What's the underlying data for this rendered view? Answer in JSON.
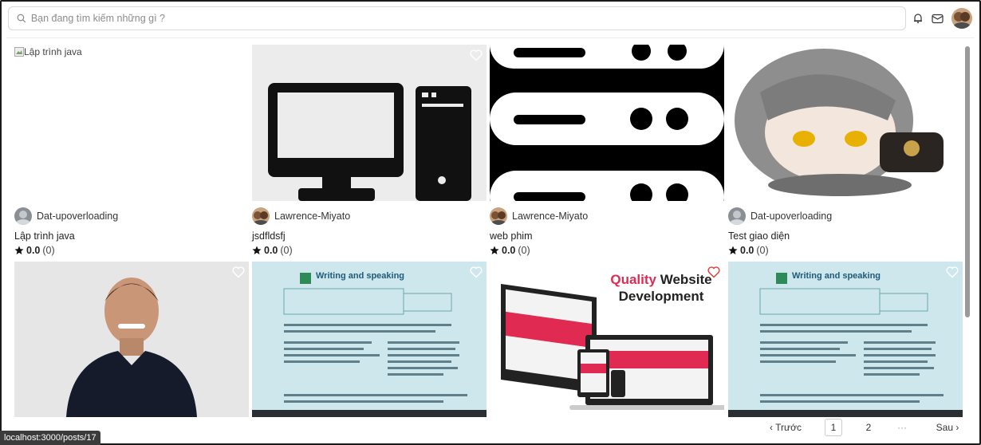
{
  "search": {
    "placeholder": "Bạn đang tìm kiếm những gì ?"
  },
  "header_icons": [
    "bell-icon",
    "mail-icon",
    "user-avatar"
  ],
  "posts": [
    {
      "author": "Dat-upoverloading",
      "title": "Lập trình java",
      "rating": "0.0",
      "count": "(0)",
      "image_alt": "Lập trình java",
      "image_broken": true
    },
    {
      "author": "Lawrence-Miyato",
      "title": "jsdfldsfj",
      "rating": "0.0",
      "count": "(0)"
    },
    {
      "author": "Lawrence-Miyato",
      "title": "web phim",
      "rating": "0.0",
      "count": "(0)"
    },
    {
      "author": "Dat-upoverloading",
      "title": "Test giao diện",
      "rating": "0.0",
      "count": "(0)"
    }
  ],
  "row2": [
    {
      "image_text": ""
    },
    {
      "image_text": "Writing and speaking"
    },
    {
      "image_text_1": "Quality",
      "image_text_2": "Website",
      "image_text_3": "Development"
    },
    {
      "image_text": "Writing and speaking"
    }
  ],
  "pagination": {
    "prev": "‹ Trước",
    "page1": "1",
    "page2": "2",
    "ellipsis": "···",
    "next": "Sau ›"
  },
  "status_url": "localhost:3000/posts/17",
  "colors": {
    "heart_active": "#e53935",
    "border": "#d9d9d9",
    "scroll": "#9a9a9a"
  }
}
